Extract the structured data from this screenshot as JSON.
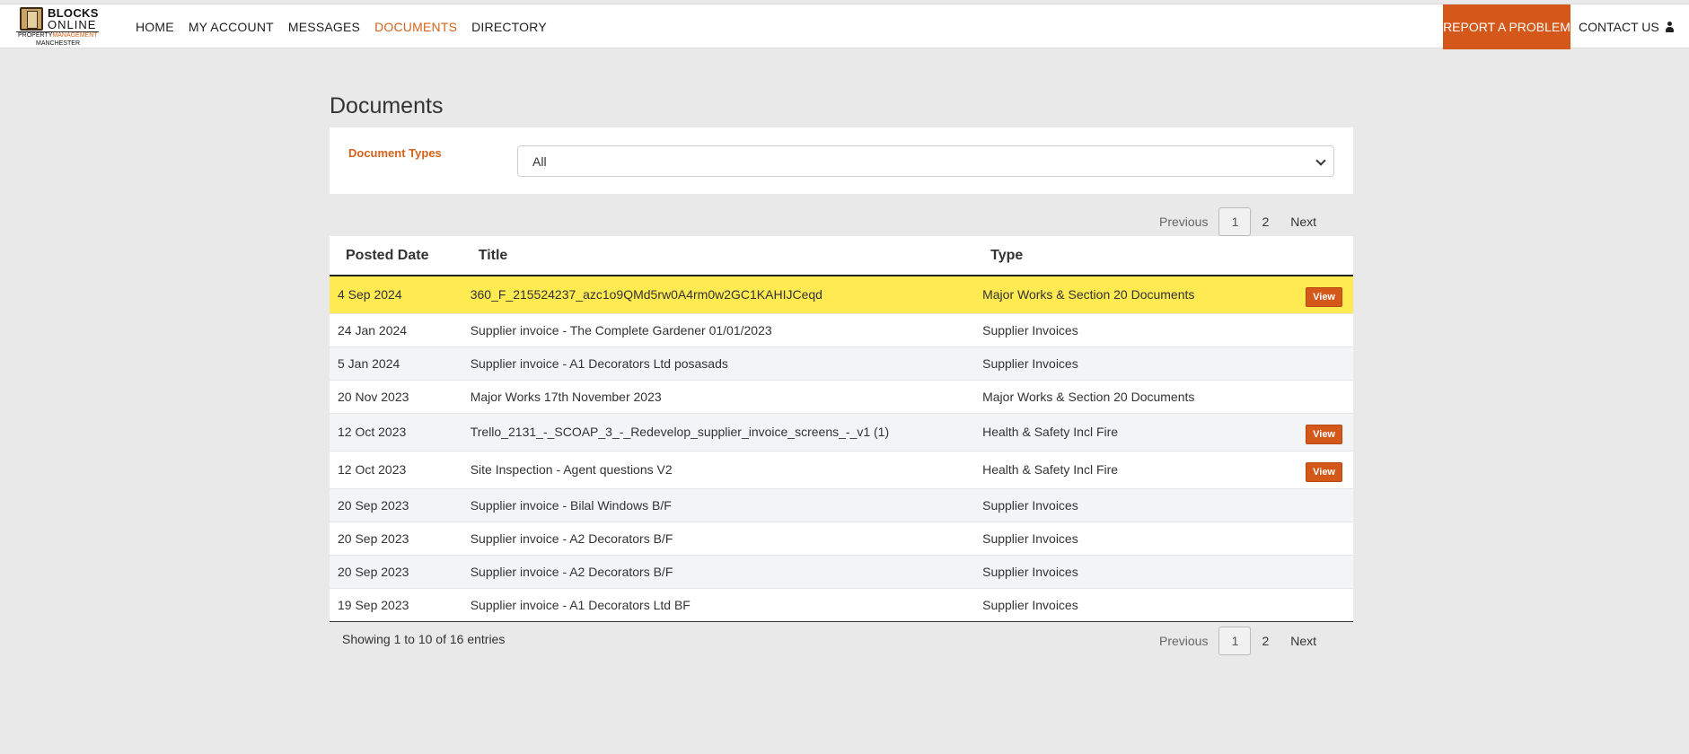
{
  "logo": {
    "line1": "BLOCKS",
    "line2": "ONLINE",
    "tag_a": "PROPERTY",
    "tag_b": "MANAGEMENT",
    "tag_c": "MANCHESTER"
  },
  "nav": {
    "items": [
      {
        "label": "HOME",
        "active": false
      },
      {
        "label": "MY ACCOUNT",
        "active": false
      },
      {
        "label": "MESSAGES",
        "active": false
      },
      {
        "label": "DOCUMENTS",
        "active": true
      },
      {
        "label": "DIRECTORY",
        "active": false
      }
    ],
    "report": "REPORT A PROBLEM",
    "contact": "CONTACT US"
  },
  "page": {
    "title": "Documents"
  },
  "filter": {
    "label": "Document Types",
    "value": "All"
  },
  "pagination": {
    "previous": "Previous",
    "pages": [
      "1",
      "2"
    ],
    "current": "1",
    "next": "Next"
  },
  "table": {
    "headers": [
      "Posted Date",
      "Title",
      "Type"
    ],
    "view_label": "View",
    "rows": [
      {
        "date": "4 Sep 2024",
        "title": "360_F_215524237_azc1o9QMd5rw0A4rm0w2GC1KAHIJCeqd",
        "type": "Major Works & Section 20 Documents",
        "view": true
      },
      {
        "date": "24 Jan 2024",
        "title": "Supplier invoice - The Complete Gardener 01/01/2023",
        "type": "Supplier Invoices",
        "view": false
      },
      {
        "date": "5 Jan 2024",
        "title": "Supplier invoice - A1 Decorators Ltd posasads",
        "type": "Supplier Invoices",
        "view": false
      },
      {
        "date": "20 Nov 2023",
        "title": "Major Works 17th November 2023",
        "type": "Major Works & Section 20 Documents",
        "view": false
      },
      {
        "date": "12 Oct 2023",
        "title": "Trello_2131_-_SCOAP_3_-_Redevelop_supplier_invoice_screens_-_v1 (1)",
        "type": "Health & Safety Incl Fire",
        "view": true
      },
      {
        "date": "12 Oct 2023",
        "title": "Site Inspection - Agent questions V2",
        "type": "Health & Safety Incl Fire",
        "view": true
      },
      {
        "date": "20 Sep 2023",
        "title": "Supplier invoice - Bilal Windows B/F",
        "type": "Supplier Invoices",
        "view": false
      },
      {
        "date": "20 Sep 2023",
        "title": "Supplier invoice - A2 Decorators B/F",
        "type": "Supplier Invoices",
        "view": false
      },
      {
        "date": "20 Sep 2023",
        "title": "Supplier invoice - A2 Decorators B/F",
        "type": "Supplier Invoices",
        "view": false
      },
      {
        "date": "19 Sep 2023",
        "title": "Supplier invoice - A1 Decorators Ltd BF",
        "type": "Supplier Invoices",
        "view": false
      }
    ]
  },
  "info": "Showing 1 to 10 of 16 entries",
  "colors": {
    "accent": "#d4581a",
    "highlight": "#ffea52"
  }
}
